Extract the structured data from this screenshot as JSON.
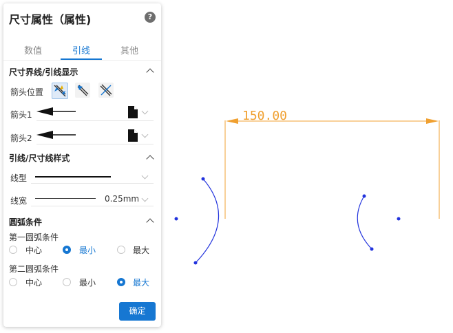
{
  "panel": {
    "title": "尺寸属性（属性)",
    "help_icon": "?",
    "tabs": [
      {
        "label": "数值"
      },
      {
        "label": "引线",
        "active": true
      },
      {
        "label": "其他"
      }
    ],
    "section_lead": {
      "title": "尺寸界线/引线显示",
      "arrow_position_label": "箭头位置",
      "arrow_position_icons": [
        "arrows-inside-icon",
        "arrows-outside-icon",
        "arrows-cross-icon"
      ],
      "arrow1_label": "箭头1",
      "arrow2_label": "箭头2"
    },
    "section_style": {
      "title": "引线/尺寸线样式",
      "line_type_label": "线型",
      "line_width_label": "线宽",
      "line_width_value": "0.25mm"
    },
    "section_arc": {
      "title": "圆弧条件",
      "first_label": "第一圆弧条件",
      "second_label": "第二圆弧条件",
      "options": [
        "中心",
        "最小",
        "最大"
      ],
      "first_selected": "最小",
      "second_selected": "最大"
    },
    "ok_label": "确定"
  },
  "drawing": {
    "dimension_text": "150.00",
    "colors": {
      "dimension": "#f0a030",
      "arc": "#2233dd",
      "accent": "#1677d2"
    }
  }
}
